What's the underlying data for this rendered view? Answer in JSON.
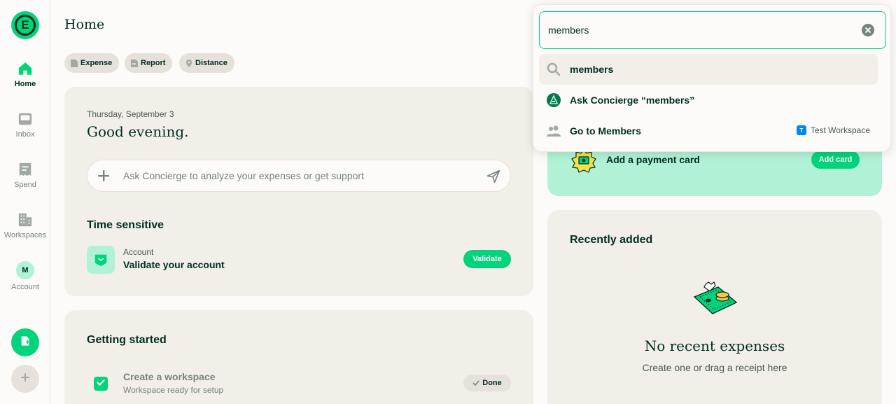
{
  "sidebar": {
    "logo_letter": "E",
    "items": [
      {
        "label": "Home",
        "icon": "home-icon"
      },
      {
        "label": "Inbox",
        "icon": "inbox-icon"
      },
      {
        "label": "Spend",
        "icon": "receipt-icon"
      },
      {
        "label": "Workspaces",
        "icon": "building-icon"
      },
      {
        "label": "Account",
        "icon": "avatar-icon",
        "initial": "M"
      }
    ]
  },
  "header": {
    "title": "Home",
    "quick_actions": [
      {
        "label": "Expense",
        "icon": "expense-icon"
      },
      {
        "label": "Report",
        "icon": "report-icon"
      },
      {
        "label": "Distance",
        "icon": "distance-icon"
      }
    ]
  },
  "welcome": {
    "date": "Thursday, September 3",
    "greeting": "Good evening.",
    "composer_placeholder": "Ask Concierge to analyze your expenses or get support"
  },
  "time_sensitive": {
    "title": "Time sensitive",
    "item_category": "Account",
    "item_title": "Validate your account",
    "action": "Validate"
  },
  "getting_started": {
    "title": "Getting started",
    "items": [
      {
        "title": "Create a workspace",
        "subtitle": "Workspace ready for setup",
        "status": "Done",
        "checked": true
      }
    ]
  },
  "payment_card": {
    "title": "Add a payment card",
    "action": "Add card"
  },
  "recently_added": {
    "title": "Recently added",
    "empty_title": "No recent expenses",
    "empty_subtitle": "Create one or drag a receipt here"
  },
  "search": {
    "query": "members",
    "results": [
      {
        "label": "members",
        "icon": "search-icon"
      },
      {
        "label": "Ask Concierge “members”",
        "icon": "concierge-icon"
      },
      {
        "label": "Go to Members",
        "icon": "users-icon",
        "workspace_initial": "T",
        "workspace": "Test Workspace"
      }
    ]
  },
  "colors": {
    "accent": "#03d47c",
    "accent_light": "#b1f2d6",
    "text_dark": "#002e22",
    "card_bg": "#f2eee8"
  }
}
